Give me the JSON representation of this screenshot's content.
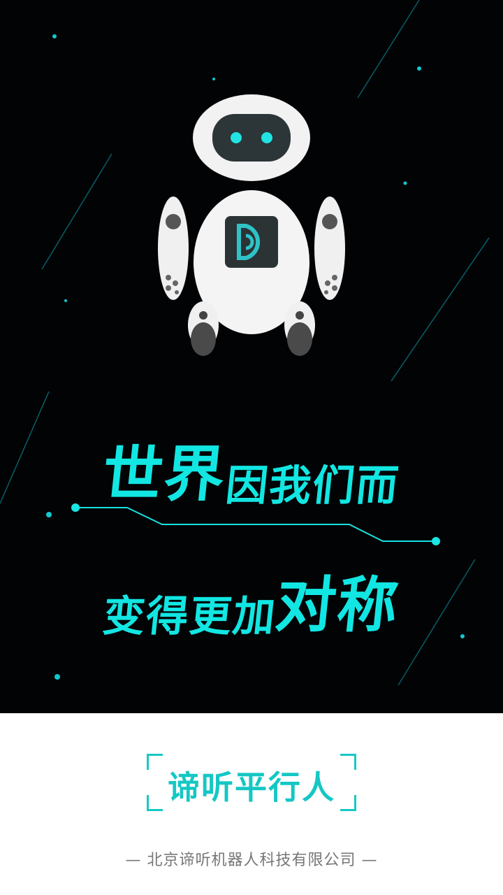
{
  "headline": {
    "line1_big": "世界",
    "line1_rest": "因我们而",
    "line2_rest": "变得更加",
    "line2_big": "对称"
  },
  "brand": {
    "name": "谛听平行人"
  },
  "footer": {
    "company": "— 北京谛听机器人科技有限公司 —"
  },
  "colors": {
    "accent": "#12e6e2",
    "background": "#020305",
    "footer_bg": "#ffffff",
    "footer_text": "#777777",
    "logo_teal": "#2fc3c8"
  },
  "icons": {
    "robot": "robot-mascot-icon",
    "chest_logo": "dt-logo-icon"
  }
}
